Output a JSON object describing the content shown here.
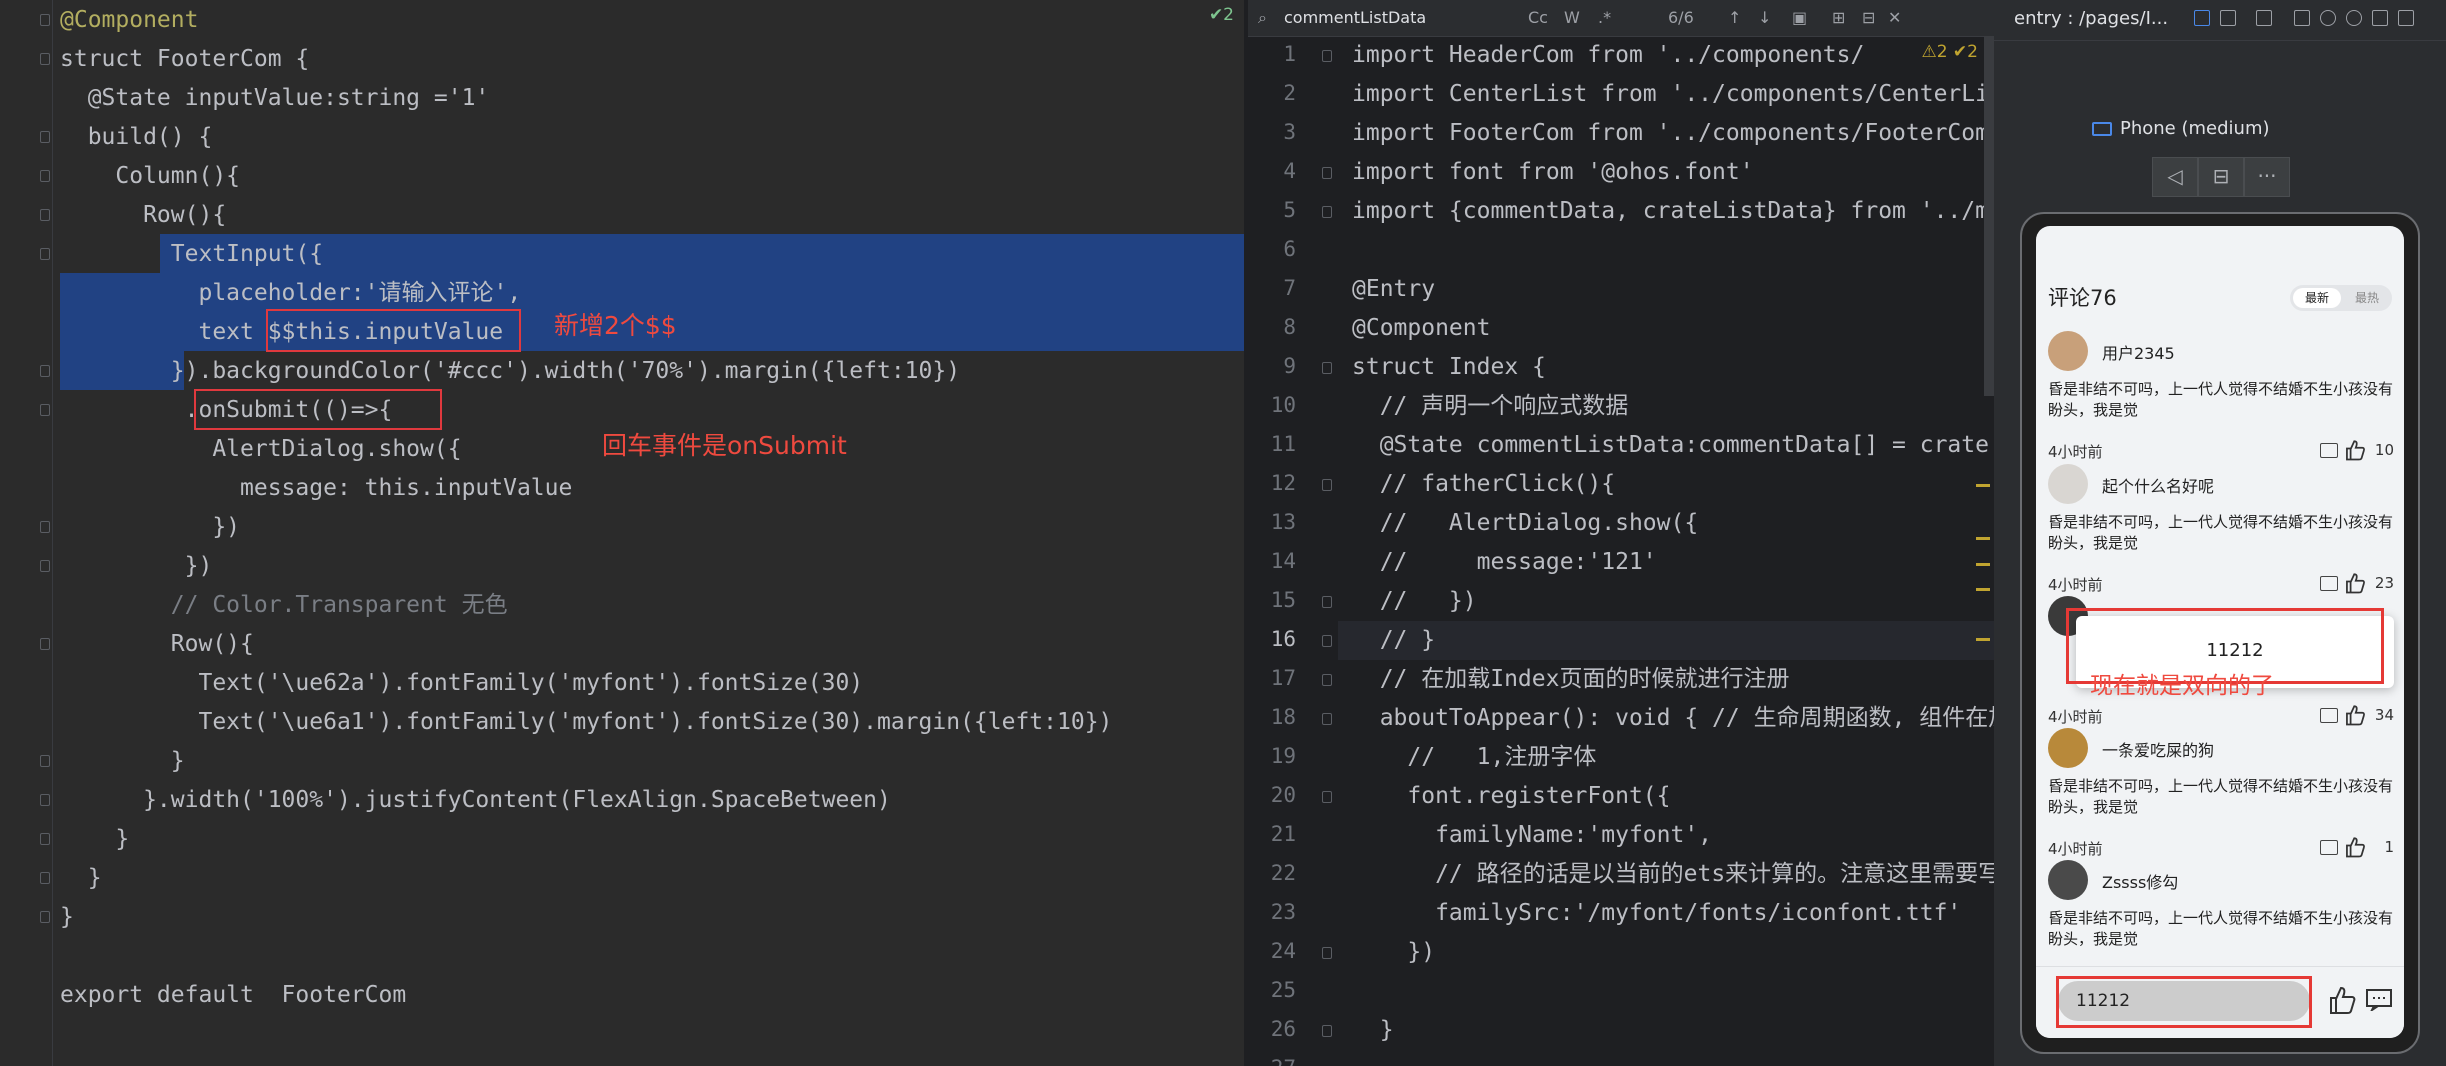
{
  "left_editor": {
    "inspection": "✔2",
    "lines": [
      {
        "t": "@Component",
        "c": "an"
      },
      {
        "t": "struct FooterCom {",
        "c": "plain"
      },
      {
        "t": "  @State inputValue:string ='1'",
        "c": "plain"
      },
      {
        "t": "  build() {",
        "c": "plain"
      },
      {
        "t": "    Column(){",
        "c": "plain"
      },
      {
        "t": "      Row(){",
        "c": "plain"
      },
      {
        "t": "        TextInput({",
        "c": "plain"
      },
      {
        "t": "          placeholder:'请输入评论',",
        "c": "plain"
      },
      {
        "t": "          text $$this.inputValue",
        "c": "plain"
      },
      {
        "t": "        }).backgroundColor('#ccc').width('70%').margin({left:10})",
        "c": "plain"
      },
      {
        "t": "         .onSubmit(()=>{",
        "c": "plain"
      },
      {
        "t": "           AlertDialog.show({",
        "c": "plain"
      },
      {
        "t": "             message: this.inputValue",
        "c": "plain"
      },
      {
        "t": "           })",
        "c": "plain"
      },
      {
        "t": "         })",
        "c": "plain"
      },
      {
        "t": "        // Color.Transparent 无色",
        "c": "cm"
      },
      {
        "t": "        Row(){",
        "c": "plain"
      },
      {
        "t": "          Text('\\ue62a').fontFamily('myfont').fontSize(30)",
        "c": "plain"
      },
      {
        "t": "          Text('\\ue6a1').fontFamily('myfont').fontSize(30).margin({left:10})",
        "c": "plain"
      },
      {
        "t": "        }",
        "c": "plain"
      },
      {
        "t": "      }.width('100%').justifyContent(FlexAlign.SpaceBetween)",
        "c": "plain"
      },
      {
        "t": "    }",
        "c": "plain"
      },
      {
        "t": "  }",
        "c": "plain"
      },
      {
        "t": "}",
        "c": "plain"
      },
      {
        "t": "",
        "c": "plain"
      },
      {
        "t": "export default  FooterCom",
        "c": "plain"
      }
    ],
    "annotation_dollar": "新增2个$$",
    "annotation_submit": "回车事件是onSubmit"
  },
  "right_editor": {
    "search_query": "commentListData",
    "match_count": "6/6",
    "search_opts": [
      "Cc",
      "W",
      ".*"
    ],
    "inspection": "⚠2 ✔2",
    "current_line": 16,
    "line_numbers": [
      1,
      2,
      3,
      4,
      5,
      6,
      7,
      8,
      9,
      10,
      11,
      12,
      13,
      14,
      15,
      16,
      17,
      18,
      19,
      20,
      21,
      22,
      23,
      24,
      25,
      26,
      27
    ],
    "lines": [
      "import HeaderCom from '../components/",
      "import CenterList from '../components/CenterLi",
      "import FooterCom from '../components/FooterCom",
      "import font from '@ohos.font'",
      "import {commentData, crateListData} from '../m",
      "",
      "@Entry",
      "@Component",
      "struct Index {",
      "  // 声明一个响应式数据",
      "  @State commentListData:commentData[] = crate",
      "  // fatherClick(){",
      "  //   AlertDialog.show({",
      "  //     message:'121'",
      "  //   })",
      "  // }",
      "  // 在加载Index页面的时候就进行注册",
      "  aboutToAppear(): void { // 生命周期函数, 组件在加",
      "    //   1,注册字体",
      "    font.registerFont({",
      "      familyName:'myfont',",
      "      // 路径的话是以当前的ets来计算的。注意这里需要写成",
      "      familySrc:'/myfont/fonts/iconfont.ttf'",
      "    })",
      "",
      "  }",
      ""
    ]
  },
  "previewer": {
    "title": "entry : /pages/I...",
    "device_label": "Phone (medium)",
    "device_controls": [
      "◁",
      "⊟",
      "···"
    ],
    "app": {
      "title": "评论76",
      "sort_latest": "最新",
      "sort_hot": "最热",
      "comments": [
        {
          "user": "用户2345",
          "text": "昏是非结不可吗，上一代人觉得不结婚不生小孩没有盼头，我是觉",
          "time": "4小时前",
          "likes": "10",
          "avatar_color": "#c8a07a"
        },
        {
          "user": "起个什么名好呢",
          "text": "昏是非结不可吗，上一代人觉得不结婚不生小孩没有盼头，我是觉",
          "time": "4小时前",
          "likes": "23",
          "avatar_color": "#d9d6d2"
        },
        {
          "user": "",
          "text": "",
          "time": "4小时前",
          "likes": "34",
          "avatar_color": "#3a3a3a"
        },
        {
          "user": "一条爱吃屎的狗",
          "text": "昏是非结不可吗，上一代人觉得不结婚不生小孩没有盼头，我是觉",
          "time": "4小时前",
          "likes": "1",
          "avatar_color": "#b8893a"
        },
        {
          "user": "Zssss修勾",
          "text": "昏是非结不可吗，上一代人觉得不结婚不生小孩没有盼头，我是觉",
          "time": "",
          "likes": "",
          "avatar_color": "#4a4a4a"
        }
      ],
      "popup_message": "11212",
      "popup_annotation": "现在就是双向的了",
      "input_value": "11212"
    }
  }
}
